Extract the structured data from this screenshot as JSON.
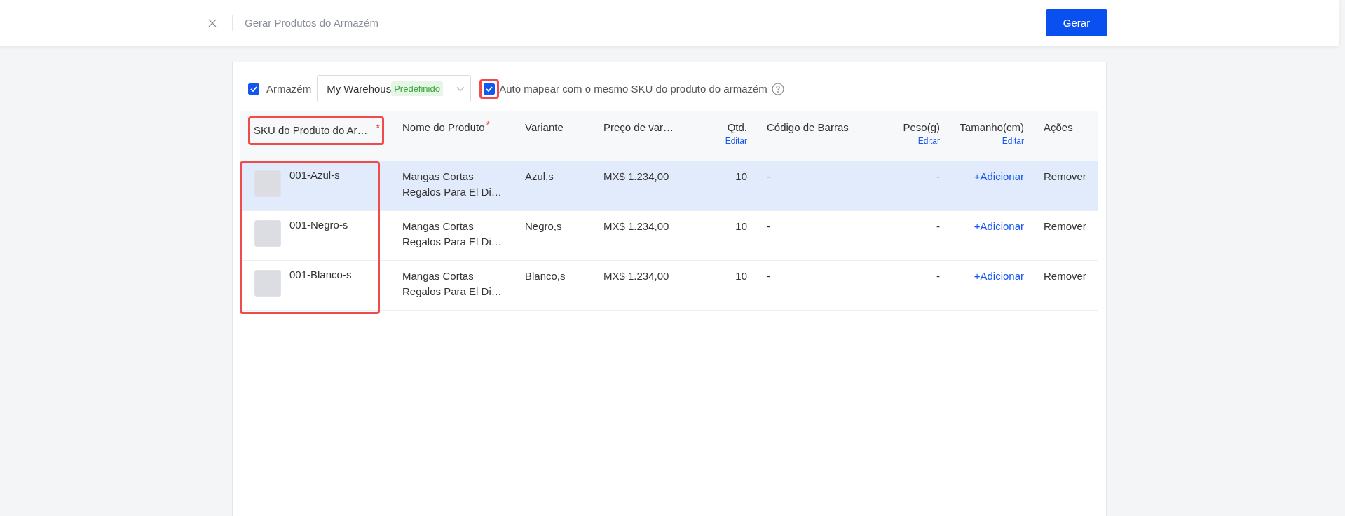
{
  "header": {
    "title": "Gerar Produtos do Armazém",
    "primary_button": "Gerar"
  },
  "filters": {
    "warehouse": {
      "checked": true,
      "label": "Armazém",
      "value": "My Warehous",
      "badge": "Predefinido"
    },
    "auto_map": {
      "checked": true,
      "highlighted": true,
      "label": "Auto mapear com o mesmo SKU do produto do armazém"
    }
  },
  "table": {
    "sku_cells_highlighted": true,
    "columns": [
      {
        "label": "SKU do Produto do Ar…",
        "required_mark": "*",
        "highlighted": true
      },
      {
        "label": "Nome do Produto",
        "required_mark": "*"
      },
      {
        "label": "Variante"
      },
      {
        "label": "Preço de var…"
      },
      {
        "label": "Qtd.",
        "action": "Editar"
      },
      {
        "label": "Código de Barras"
      },
      {
        "label": "Peso(g)",
        "action": "Editar"
      },
      {
        "label": "Tamanho(cm)",
        "action": "Editar"
      },
      {
        "label": "Ações"
      }
    ],
    "rows": [
      {
        "selected": true,
        "sku": "001-Azul-s",
        "name": "Mangas Cortas Regalos Para El Di…",
        "variant": "Azul,s",
        "price": "MX$ 1.234,00",
        "qty": "10",
        "barcode": "-",
        "weight": "-",
        "size": "+Adicionar",
        "action": "Remover"
      },
      {
        "selected": false,
        "sku": "001-Negro-s",
        "name": "Mangas Cortas Regalos Para El Di…",
        "variant": "Negro,s",
        "price": "MX$ 1.234,00",
        "qty": "10",
        "barcode": "-",
        "weight": "-",
        "size": "+Adicionar",
        "action": "Remover"
      },
      {
        "selected": false,
        "sku": "001-Blanco-s",
        "name": "Mangas Cortas Regalos Para El Di…",
        "variant": "Blanco,s",
        "price": "MX$ 1.234,00",
        "qty": "10",
        "barcode": "-",
        "weight": "-",
        "size": "+Adicionar",
        "action": "Remover"
      }
    ]
  }
}
